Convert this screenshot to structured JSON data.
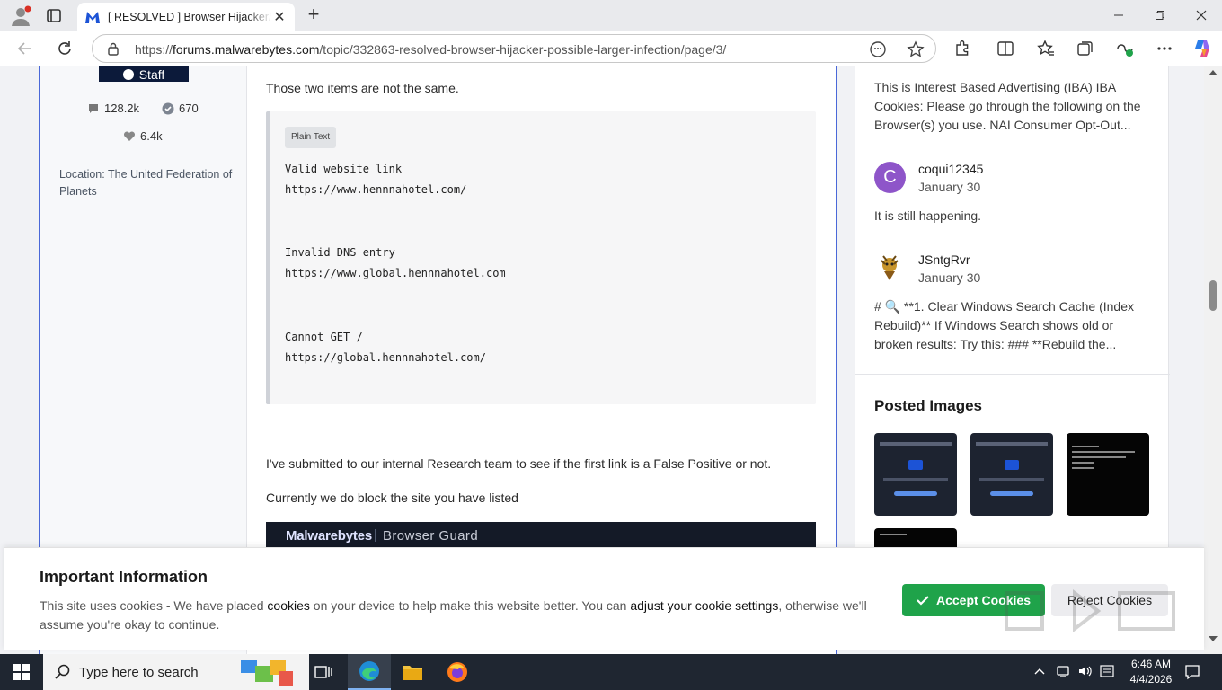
{
  "browser": {
    "tab_title": "[ RESOLVED ] Browser Hijacker/ Possible Larger Infection",
    "url_prefix": "https://",
    "url_domain": "forums.malwarebytes.com",
    "url_path": "/topic/332863-resolved-browser-hijacker-possible-larger-infection/page/3/"
  },
  "author": {
    "badge_label": "Staff",
    "posts_count": "128.2k",
    "solutions_count": "670",
    "reputation": "6.4k",
    "location": "Location: The United Federation of Planets"
  },
  "post": {
    "intro": "Those two items are not the same.",
    "code_label": "Plain Text",
    "code_lines": [
      "Valid website link",
      "https://www.hennnahotel.com/",
      "Invalid DNS entry",
      "https://www.global.hennnahotel.com",
      "Cannot GET /",
      "https://global.hennnahotel.com/"
    ],
    "para1": "I've submitted to our internal Research team to see if the first link is a False Positive or not.",
    "para2": "Currently we do block the site you have listed",
    "banner_brand": "Malwarebytes",
    "banner_product": "Browser Guard"
  },
  "sidebar": {
    "excerpt1": "This is Interest Based Advertising (IBA) IBA Cookies: Please go through the following on the Browser(s) you use. NAI Consumer Opt-Out...",
    "user1": {
      "initial": "C",
      "name": "coqui12345",
      "date": "January 30",
      "text": "It is still happening."
    },
    "user2": {
      "name": "JSntgRvr",
      "date": "January 30",
      "text": "# 🔍 **1. Clear Windows Search Cache (Index Rebuild)** If Windows Search shows old or broken results: Try this: ### **Rebuild the..."
    },
    "posted_images_title": "Posted Images"
  },
  "cookie": {
    "title": "Important Information",
    "text_before": "This site uses cookies - We have placed ",
    "link1": "cookies",
    "text_mid": " on your device to help make this website better. You can ",
    "link2": "adjust your cookie settings",
    "text_after": ", otherwise we'll assume you're okay to continue.",
    "accept_label": "Accept Cookies",
    "reject_label": "Reject Cookies"
  },
  "taskbar": {
    "search_placeholder": "Type here to search",
    "time": "6:46 AM",
    "date": "4/4/2026"
  },
  "colors": {
    "accent_blue": "#4a68d8",
    "accept_green": "#1fa34a",
    "taskbar": "#1f2631"
  }
}
